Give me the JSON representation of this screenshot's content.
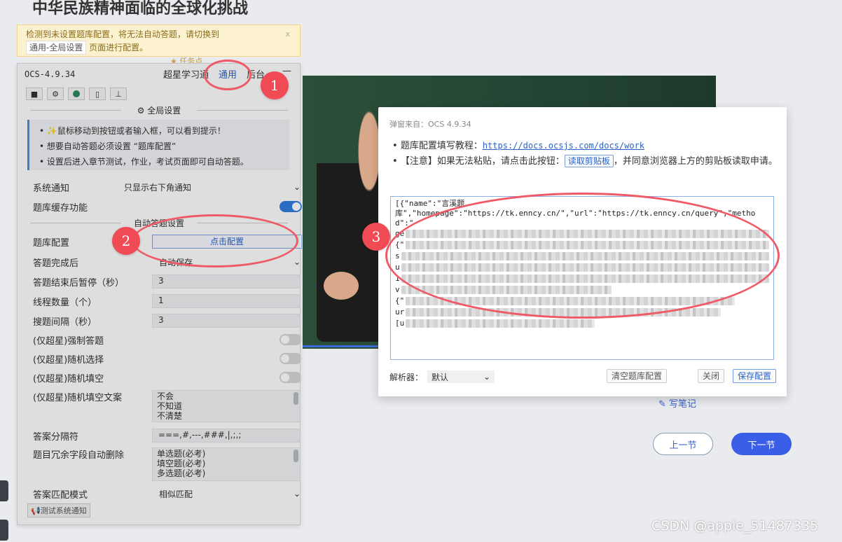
{
  "page": {
    "title": "中华民族精神面临的全球化挑战",
    "write_note": "写笔记",
    "prev": "上一节",
    "next": "下一节",
    "task_tag": "任务点",
    "watermark": "CSDN @apple_51487335"
  },
  "warning": {
    "line1": "检测到未设置题库配置，将无法自动答题，请切换到",
    "tag": "通用-全局设置",
    "line2": "页面进行配置。",
    "close": "x"
  },
  "ocs": {
    "version": "OCS-4.9.34",
    "tabs": [
      "超星学习通",
      "通用",
      "后台"
    ],
    "minimize": "—",
    "toolbar_icons": [
      "monitor-icon",
      "gear-icon",
      "globe-icon",
      "document-icon",
      "stamp-icon"
    ],
    "global_settings": "全局设置",
    "tips": [
      "✨鼠标移动到按钮或者输入框，可以看到提示！",
      "想要自动答题必须设置 “题库配置”",
      "设置后进入章节测试，作业，考试页面即可自动答题。"
    ],
    "notify": {
      "label": "系统通知",
      "value": "只显示右下角通知"
    },
    "cache": {
      "label": "题库缓存功能",
      "on": true
    },
    "auto_answer_title": "自动答题设置",
    "bank_config": {
      "label": "题库配置",
      "button": "点击配置"
    },
    "after_answer": {
      "label": "答题完成后",
      "value": "自动保存"
    },
    "pause": {
      "label": "答题结束后暂停（秒）",
      "value": "3"
    },
    "threads": {
      "label": "线程数量（个）",
      "value": "1"
    },
    "interval": {
      "label": "搜题间隔（秒）",
      "value": "3"
    },
    "force": {
      "label": "(仅超星)强制答题",
      "on": false
    },
    "random_choice": {
      "label": "(仅超星)随机选择",
      "on": false
    },
    "random_fill": {
      "label": "(仅超星)随机填空",
      "on": false
    },
    "random_text": {
      "label": "(仅超星)随机填空文案",
      "lines": [
        "不会",
        "不知道",
        "不清楚"
      ]
    },
    "separator": {
      "label": "答案分隔符",
      "value": "===,#,---,###,|,;,;"
    },
    "redundant": {
      "label": "题目冗余字段自动删除",
      "lines": [
        "单选题(必考)",
        "填空题(必考)",
        "多选题(必考)"
      ]
    },
    "match_mode": {
      "label": "答案匹配模式",
      "value": "相似匹配"
    },
    "test_notify": "📢测试系统通知"
  },
  "modal": {
    "from": "弹窗来自：OCS 4.9.34",
    "tip1_prefix": "题库配置填写教程：",
    "tip1_link": "https://docs.ocsjs.com/docs/work",
    "tip2_prefix": "【注意】如果无法粘贴，请点击此按钮：",
    "tip2_button": "读取剪贴板",
    "tip2_suffix": "，并同意浏览器上方的剪贴板读取申请。",
    "config_line1": "[{\"name\":\"言溪题",
    "config_line2": "库\",\"homepage\":\"https://tk.enncy.cn/\",\"url\":\"https://tk.enncy.cn/query\",\"method\":\"",
    "config_prefixes": [
      "ge",
      "{\"",
      "s",
      "u",
      "1",
      "v",
      "{\"",
      "ur",
      "[u"
    ],
    "parser_label": "解析器：",
    "parser_value": "默认",
    "clear": "清空题库配置",
    "close": "关闭",
    "save": "保存配置"
  },
  "annotations": {
    "n1": "1",
    "n2": "2",
    "n3": "3"
  },
  "colors": {
    "accent": "#2f7de1",
    "annotation": "#f04a55",
    "primary_button": "#3a5ee8"
  }
}
